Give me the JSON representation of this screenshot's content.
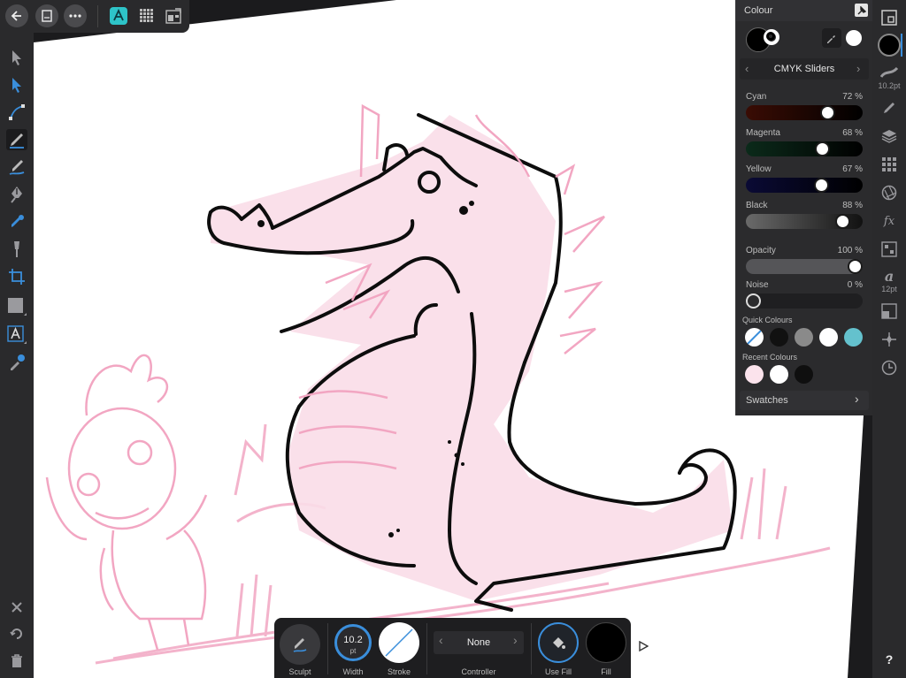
{
  "colors": {
    "sketch_pink": "#f2a6c2",
    "ink": "#0d0d0d",
    "accent_blue": "#3a8edb",
    "teal": "#2ec4c8",
    "quick_teal": "#64c1cd"
  },
  "topbar": {
    "back_icon": "arrow-left-icon",
    "document_icon": "document-icon",
    "more_icon": "more-icon",
    "persona_designer_icon": "designer-persona-icon",
    "persona_pixel_icon": "pixel-persona-icon",
    "persona_export_icon": "export-persona-icon"
  },
  "colour_panel": {
    "title": "Colour",
    "mode": "CMYK Sliders",
    "sliders": [
      {
        "label": "Cyan",
        "value": "72 %",
        "fraction": 0.72
      },
      {
        "label": "Magenta",
        "value": "68 %",
        "fraction": 0.68
      },
      {
        "label": "Yellow",
        "value": "67 %",
        "fraction": 0.67
      },
      {
        "label": "Black",
        "value": "88 %",
        "fraction": 0.88
      }
    ],
    "opacity": {
      "label": "Opacity",
      "value": "100 %",
      "fraction": 1.0
    },
    "noise": {
      "label": "Noise",
      "value": "0 %",
      "fraction": 0.0
    },
    "quick_colours_label": "Quick Colours",
    "quick_colours": [
      "none",
      "#111111",
      "#8a8a8a",
      "#ffffff",
      "#64c1cd"
    ],
    "recent_colours_label": "Recent Colours",
    "recent_colours": [
      "#fbe3ec",
      "#ffffff",
      "#0f0f0f"
    ],
    "swatches_label": "Swatches"
  },
  "right_strip": {
    "stroke_width_label": "10.2pt",
    "font_size_label": "12pt"
  },
  "context_bar": {
    "sculpt_label": "Sculpt",
    "width_value": "10.2",
    "width_unit": "pt",
    "width_label": "Width",
    "stroke_label": "Stroke",
    "controller_value": "None",
    "controller_label": "Controller",
    "use_fill_label": "Use Fill",
    "fill_label": "Fill"
  },
  "left_bottom": {
    "help": "?"
  }
}
